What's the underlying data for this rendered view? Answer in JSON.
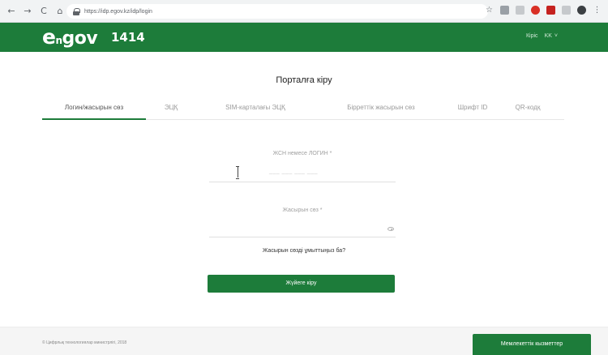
{
  "browser": {
    "back_icon": "←",
    "forward_icon": "→",
    "reload_icon": "C",
    "home_icon": "⌂",
    "url": "https://idp.egov.kz/idp/login",
    "star_icon": "☆",
    "menu_icon": "⋮"
  },
  "header": {
    "logo_e": "e",
    "logo_sub": "n",
    "logo_gov": "gov",
    "hotline": "1414",
    "link": "Кіріс",
    "lang": "KK",
    "lang_chevron": "˅",
    "colors": {
      "brand": "#1d7c3a"
    }
  },
  "main": {
    "title": "Порталға кіру",
    "tabs": [
      {
        "label": "Логин/жасырын сөз",
        "active": true
      },
      {
        "label": "ЭЦҚ",
        "active": false
      },
      {
        "label": "SIM-карталағы ЭЦҚ",
        "active": false
      },
      {
        "label": "Бірреттік жасырын сөз",
        "active": false
      },
      {
        "label": "Шрифт ID",
        "active": false
      },
      {
        "label": "QR-кодқ",
        "active": false
      }
    ],
    "iin_label": "ЖСН немесе ЛОГИН *",
    "iin_placeholder": "___ ___ ___ ___",
    "password_label": "Жасырын сөз *",
    "forgot_link": "Жасырын сөзді ұмыттыңыз ба?",
    "login_button": "Жүйеге кіру"
  },
  "footer": {
    "copyright": "© Цифрлық технологиялар министрлігі, 2018",
    "feedback_button": "Мемлекеттік кызметтер"
  }
}
